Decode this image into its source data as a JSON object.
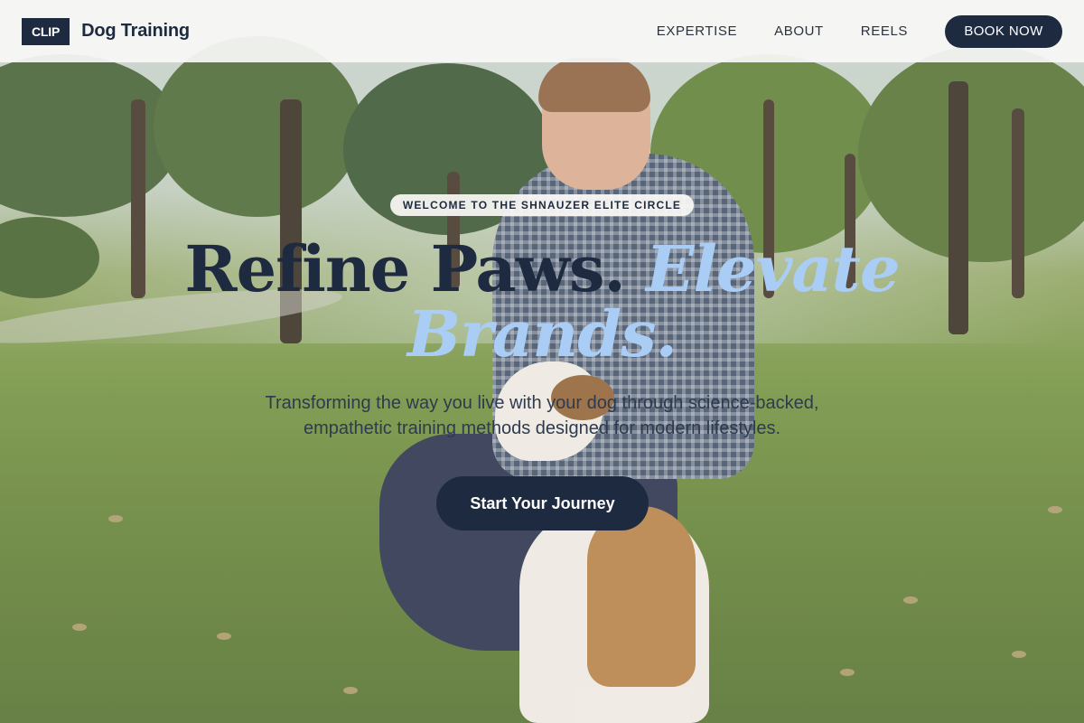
{
  "nav": {
    "logo_badge": "CLIP",
    "logo_text": "Dog Training",
    "links": [
      "EXPERTISE",
      "ABOUT",
      "REELS"
    ],
    "cta": "BOOK NOW"
  },
  "hero": {
    "eyebrow": "WELCOME TO THE SHNAUZER ELITE CIRCLE",
    "headline_part1": "Refine Paws. ",
    "headline_accent": "Elevate Brands.",
    "subtitle": "Transforming the way you live with your dog through science-backed, empathetic training methods designed for modern lifestyles.",
    "cta": "Start Your Journey"
  },
  "colors": {
    "navy": "#1e2a3f",
    "accent_blue": "#a9cdf5",
    "nav_bg": "#f8f8f6"
  }
}
